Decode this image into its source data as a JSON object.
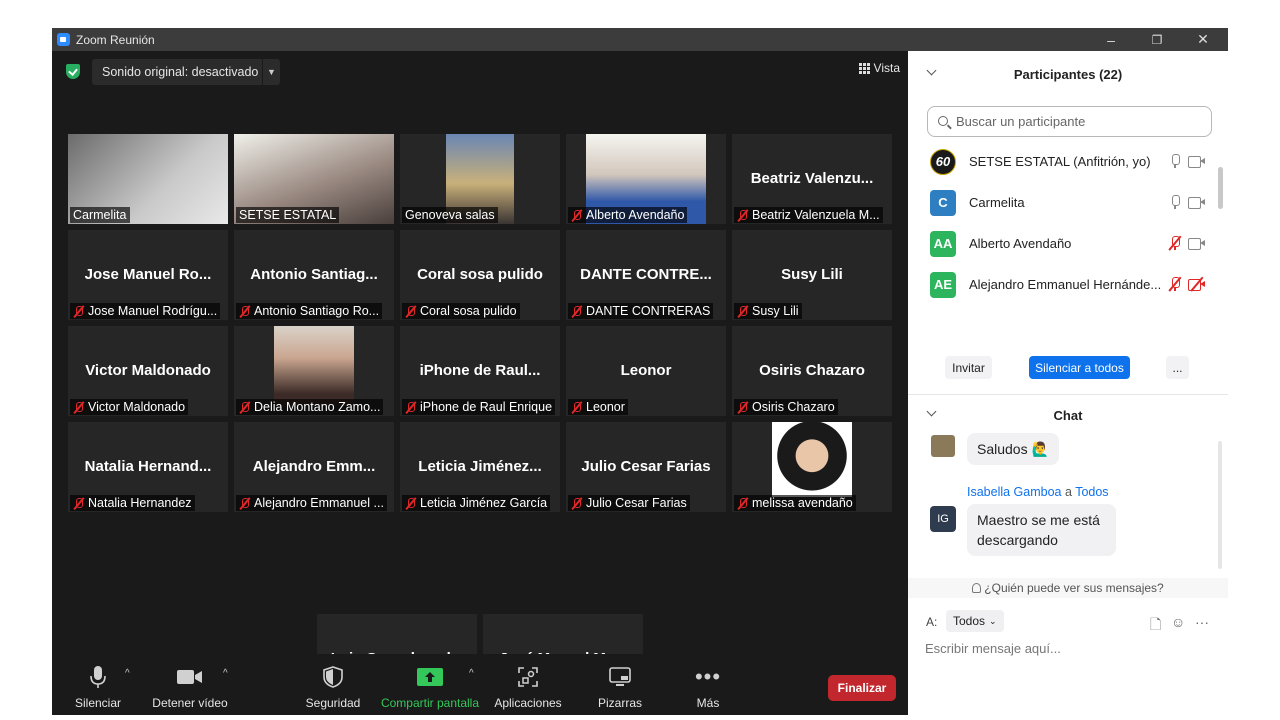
{
  "window": {
    "title": "Zoom Reunión",
    "controls": [
      "–",
      "❐",
      "✕"
    ]
  },
  "top_bar": {
    "sound_label": "Sonido original: desactivado",
    "view_label": "Vista"
  },
  "tiles": [
    {
      "name": "Carmelita",
      "display": "",
      "muted": false,
      "active": true
    },
    {
      "name": "SETSE ESTATAL",
      "display": "",
      "muted": false
    },
    {
      "name": "Genoveva salas",
      "display": "",
      "muted": false
    },
    {
      "name": "Alberto Avendaño",
      "display": "",
      "muted": true
    },
    {
      "name": "Beatriz Valenzuela M...",
      "display": "Beatriz Valenzu...",
      "muted": true
    },
    {
      "name": "Jose Manuel Rodrígu...",
      "display": "Jose Manuel Ro...",
      "muted": true
    },
    {
      "name": "Antonio Santiago Ro...",
      "display": "Antonio Santiag...",
      "muted": true
    },
    {
      "name": "Coral sosa pulido",
      "display": "Coral sosa pulido",
      "muted": true
    },
    {
      "name": "DANTE CONTRERAS",
      "display": "DANTE CONTRE...",
      "muted": true
    },
    {
      "name": "Susy Lili",
      "display": "Susy Lili",
      "muted": true
    },
    {
      "name": "Victor Maldonado",
      "display": "Victor Maldonado",
      "muted": true
    },
    {
      "name": "Delia Montano Zamo...",
      "display": "",
      "muted": true
    },
    {
      "name": "iPhone de Raul Enrique",
      "display": "iPhone de Raul...",
      "muted": true
    },
    {
      "name": "Leonor",
      "display": "Leonor",
      "muted": true
    },
    {
      "name": "Osiris Chazaro",
      "display": "Osiris Chazaro",
      "muted": true
    },
    {
      "name": "Natalia Hernandez",
      "display": "Natalia Hernand...",
      "muted": true
    },
    {
      "name": "Alejandro Emmanuel ...",
      "display": "Alejandro Emm...",
      "muted": true
    },
    {
      "name": "Leticia Jiménez García",
      "display": "Leticia Jiménez...",
      "muted": true
    },
    {
      "name": "Julio Cesar Farias",
      "display": "Julio Cesar Farias",
      "muted": true
    },
    {
      "name": "melissa avendaño",
      "display": "",
      "muted": true
    },
    {
      "name": "Luis Gerardo polo pi...",
      "display": "Luis Gerardo pol...",
      "muted": true
    },
    {
      "name": "José Manuel Martíne...",
      "display": "José Manuel Ma...",
      "muted": true
    }
  ],
  "toolbar": {
    "mute": "Silenciar",
    "video": "Detener vídeo",
    "security": "Seguridad",
    "share": "Compartir pantalla",
    "apps": "Aplicaciones",
    "whiteboards": "Pizarras",
    "more": "Más",
    "end": "Finalizar"
  },
  "participants": {
    "title": "Participantes (22)",
    "search_placeholder": "Buscar un participante",
    "list": [
      {
        "initials": "60",
        "name": "SETSE ESTATAL (Anfitrión, yo)",
        "color": "#1a1a1a"
      },
      {
        "initials": "C",
        "name": "Carmelita",
        "color": "#2d7fc1"
      },
      {
        "initials": "AA",
        "name": "Alberto Avendaño",
        "color": "#2db55d"
      },
      {
        "initials": "AE",
        "name": "Alejandro Emmanuel Hernánde...",
        "color": "#2db55d"
      }
    ],
    "invite": "Invitar",
    "mute_all": "Silenciar a todos",
    "more": "..."
  },
  "chat": {
    "title": "Chat",
    "messages": [
      {
        "text": "Saludos 🙋‍♂️"
      },
      {
        "sender": "Isabella Gamboa",
        "to_word": "a",
        "recipient": "Todos",
        "initials": "IG",
        "text_line1": "Maestro se me está",
        "text_line2": "descargando"
      }
    ],
    "who_can_see": "¿Quién puede ver sus mensajes?",
    "to_label": "A:",
    "to_value": "Todos",
    "input_placeholder": "Escribir mensaje aquí..."
  }
}
